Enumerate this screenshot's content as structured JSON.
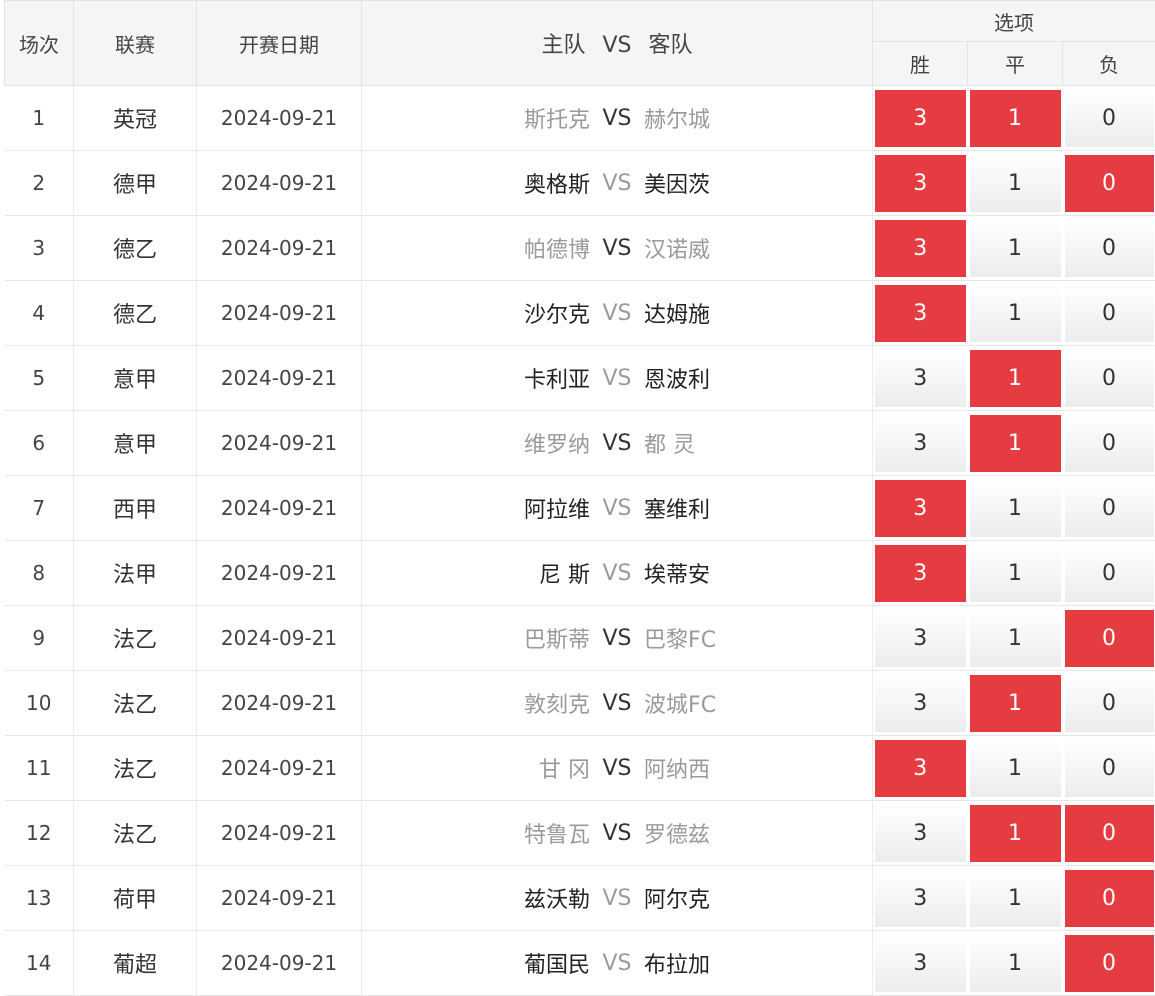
{
  "header": {
    "no": "场次",
    "league": "联赛",
    "date": "开赛日期",
    "home": "主队",
    "vs": "VS",
    "away": "客队",
    "options": "选项",
    "win": "胜",
    "draw": "平",
    "lose": "负"
  },
  "accent_color": "#e43c40",
  "rows": [
    {
      "no": "1",
      "league": "英冠",
      "date": "2024-09-21",
      "home": "斯托克",
      "vs": "VS",
      "away": "赫尔城",
      "win": "3",
      "draw": "1",
      "lose": "0"
    },
    {
      "no": "2",
      "league": "德甲",
      "date": "2024-09-21",
      "home": "奥格斯",
      "vs": "VS",
      "away": "美因茨",
      "win": "3",
      "draw": "1",
      "lose": "0"
    },
    {
      "no": "3",
      "league": "德乙",
      "date": "2024-09-21",
      "home": "帕德博",
      "vs": "VS",
      "away": "汉诺威",
      "win": "3",
      "draw": "1",
      "lose": "0"
    },
    {
      "no": "4",
      "league": "德乙",
      "date": "2024-09-21",
      "home": "沙尔克",
      "vs": "VS",
      "away": "达姆施",
      "win": "3",
      "draw": "1",
      "lose": "0"
    },
    {
      "no": "5",
      "league": "意甲",
      "date": "2024-09-21",
      "home": "卡利亚",
      "vs": "VS",
      "away": "恩波利",
      "win": "3",
      "draw": "1",
      "lose": "0"
    },
    {
      "no": "6",
      "league": "意甲",
      "date": "2024-09-21",
      "home": "维罗纳",
      "vs": "VS",
      "away": "都 灵",
      "win": "3",
      "draw": "1",
      "lose": "0"
    },
    {
      "no": "7",
      "league": "西甲",
      "date": "2024-09-21",
      "home": "阿拉维",
      "vs": "VS",
      "away": "塞维利",
      "win": "3",
      "draw": "1",
      "lose": "0"
    },
    {
      "no": "8",
      "league": "法甲",
      "date": "2024-09-21",
      "home": "尼 斯",
      "vs": "VS",
      "away": "埃蒂安",
      "win": "3",
      "draw": "1",
      "lose": "0"
    },
    {
      "no": "9",
      "league": "法乙",
      "date": "2024-09-21",
      "home": "巴斯蒂",
      "vs": "VS",
      "away": "巴黎FC",
      "win": "3",
      "draw": "1",
      "lose": "0"
    },
    {
      "no": "10",
      "league": "法乙",
      "date": "2024-09-21",
      "home": "敦刻克",
      "vs": "VS",
      "away": "波城FC",
      "win": "3",
      "draw": "1",
      "lose": "0"
    },
    {
      "no": "11",
      "league": "法乙",
      "date": "2024-09-21",
      "home": "甘 冈",
      "vs": "VS",
      "away": "阿纳西",
      "win": "3",
      "draw": "1",
      "lose": "0"
    },
    {
      "no": "12",
      "league": "法乙",
      "date": "2024-09-21",
      "home": "特鲁瓦",
      "vs": "VS",
      "away": "罗德兹",
      "win": "3",
      "draw": "1",
      "lose": "0"
    },
    {
      "no": "13",
      "league": "荷甲",
      "date": "2024-09-21",
      "home": "兹沃勒",
      "vs": "VS",
      "away": "阿尔克",
      "win": "3",
      "draw": "1",
      "lose": "0"
    },
    {
      "no": "14",
      "league": "葡超",
      "date": "2024-09-21",
      "home": "葡国民",
      "vs": "VS",
      "away": "布拉加",
      "win": "3",
      "draw": "1",
      "lose": "0"
    }
  ]
}
